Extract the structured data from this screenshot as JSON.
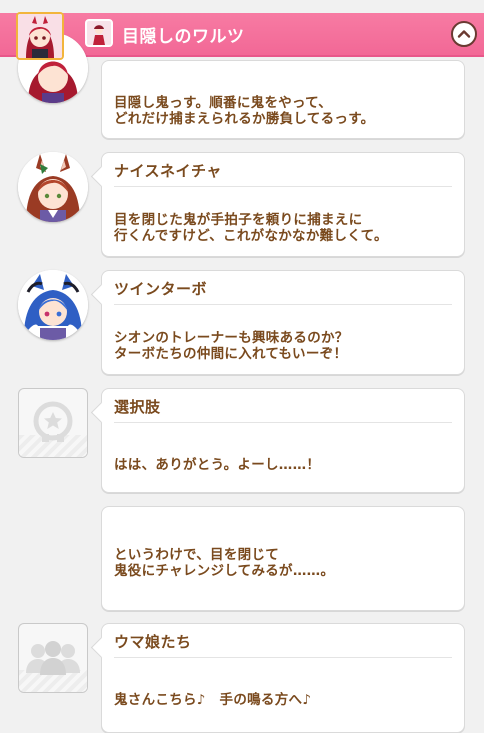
{
  "header": {
    "title": "目隠しのワルツ"
  },
  "messages": [
    {
      "speaker": "",
      "lines": [
        "目隠し鬼っす。順番に鬼をやって、",
        "どれだけ捕まえられるか勝負してるっす。"
      ],
      "avatar": "red-haired-girl-avatar"
    },
    {
      "speaker": "ナイスネイチャ",
      "lines": [
        "目を閉じた鬼が手拍子を頼りに捕まえに",
        "行くんですけど、これがなかなか難しくて。"
      ],
      "avatar": "nice-nature-avatar"
    },
    {
      "speaker": "ツインターボ",
      "lines": [
        "シオンのトレーナーも興味あるのか？",
        "ターボたちの仲間に入れてもいーぞ！"
      ],
      "avatar": "twin-turbo-avatar"
    },
    {
      "speaker": "選択肢",
      "lines": [
        "はは、ありがとう。よーし……！"
      ],
      "avatar": "choice-placeholder-icon"
    },
    {
      "speaker": "",
      "lines": [
        "というわけで、目を閉じて",
        "鬼役にチャレンジしてみるが……。"
      ],
      "avatar": ""
    },
    {
      "speaker": "ウマ娘たち",
      "lines": [
        "鬼さんこちら♪　手の鳴る方へ♪"
      ],
      "avatar": "group-placeholder-icon"
    }
  ],
  "colors": {
    "header_pink": "#f26896",
    "text_brown": "#7a4a1e",
    "background": "#f1f1f1"
  }
}
